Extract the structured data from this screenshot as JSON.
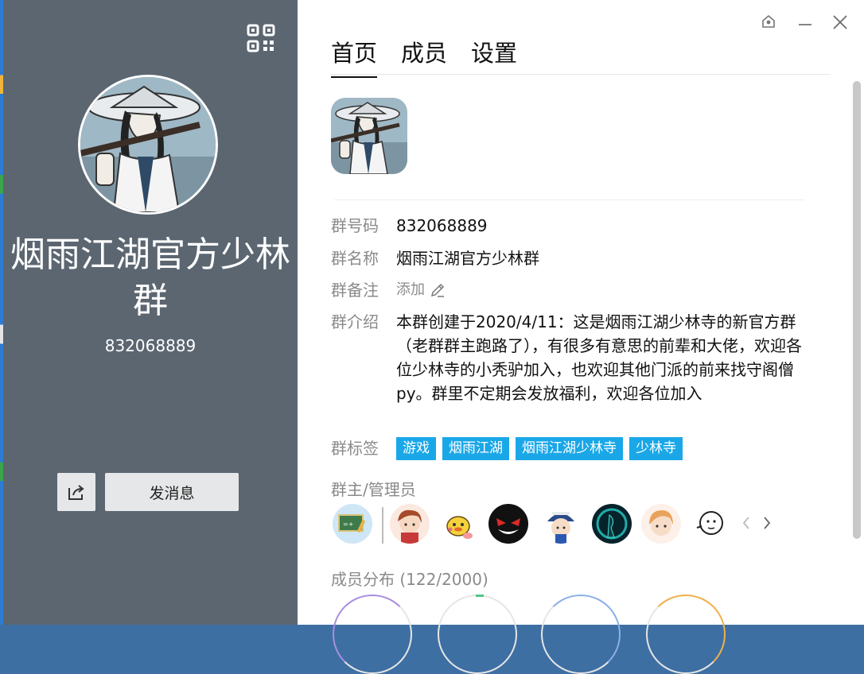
{
  "left_panel": {
    "title": "烟雨江湖官方少林群",
    "number": "832068889",
    "send_button": "发消息"
  },
  "tabs": [
    {
      "label": "首页"
    },
    {
      "label": "成员"
    },
    {
      "label": "设置"
    }
  ],
  "info": {
    "number_label": "群号码",
    "number_value": "832068889",
    "name_label": "群名称",
    "name_value": "烟雨江湖官方少林群",
    "note_label": "群备注",
    "note_add": "添加",
    "intro_label": "群介绍",
    "intro_value": "本群创建于2020/4/11：这是烟雨江湖少林寺的新官方群（老群群主跑路了），有很多有意思的前辈和大佬，欢迎各位少林寺的小秃驴加入，也欢迎其他门派的前来找守阁僧py。群里不定期会发放福利，欢迎各位加入",
    "tags_label": "群标签",
    "tags": [
      "游戏",
      "烟雨江湖",
      "烟雨江湖少林寺",
      "少林寺"
    ]
  },
  "admins_label": "群主/管理员",
  "distribution_label": "成员分布 (122/2000)",
  "colors": {
    "left_panel_bg": "#5b6671",
    "tag_bg": "#1aa7e8",
    "text_gray": "#8a8a8a"
  },
  "icons": [
    "qr-code-icon",
    "share-icon",
    "pin-icon",
    "minimize-icon",
    "close-icon",
    "pencil-icon",
    "chevron-left-icon",
    "chevron-right-icon"
  ]
}
